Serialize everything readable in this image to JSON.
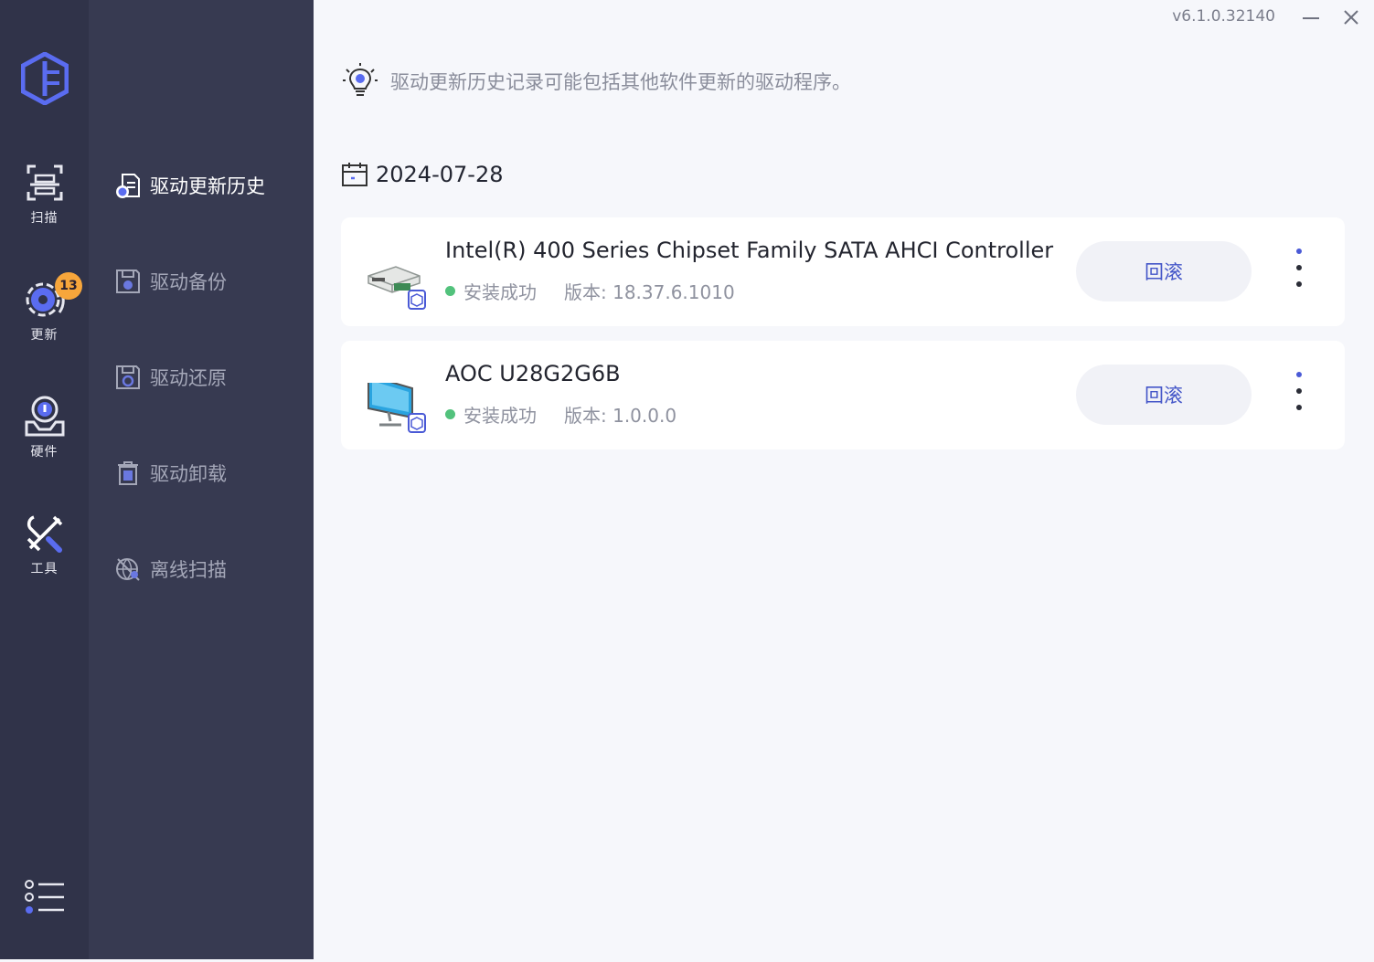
{
  "app": {
    "version": "v6.1.0.32140"
  },
  "rail": {
    "items": [
      {
        "label": "扫描",
        "icon": "scan-icon"
      },
      {
        "label": "更新",
        "icon": "update-gear-icon",
        "badge": "13"
      },
      {
        "label": "硬件",
        "icon": "hardware-icon"
      },
      {
        "label": "工具",
        "icon": "tools-icon",
        "active": true
      }
    ],
    "menu_icon": "list-menu-icon"
  },
  "sidebar": {
    "items": [
      {
        "label": "驱动更新历史",
        "icon": "history-icon",
        "active": true
      },
      {
        "label": "驱动备份",
        "icon": "backup-icon"
      },
      {
        "label": "驱动还原",
        "icon": "restore-icon"
      },
      {
        "label": "驱动卸载",
        "icon": "uninstall-icon"
      },
      {
        "label": "离线扫描",
        "icon": "offline-scan-icon"
      }
    ]
  },
  "main": {
    "tip": "驱动更新历史记录可能包括其他软件更新的驱动程序。",
    "date": "2024-07-28",
    "records": [
      {
        "name": "Intel(R) 400 Series Chipset Family SATA AHCI Controller",
        "status": "安装成功",
        "version": "版本: 18.37.6.1010",
        "action": "回滚",
        "icon": "controller-card-icon"
      },
      {
        "name": "AOC U28G2G6B",
        "status": "安装成功",
        "version": "版本: 1.0.0.0",
        "action": "回滚",
        "icon": "monitor-icon"
      }
    ]
  },
  "colors": {
    "rail_bg": "#303349",
    "sidebar_bg": "#373a51",
    "main_bg": "#f6f7fb",
    "accent": "#4456c8",
    "success": "#52c27c",
    "badge": "#f7a63b"
  }
}
